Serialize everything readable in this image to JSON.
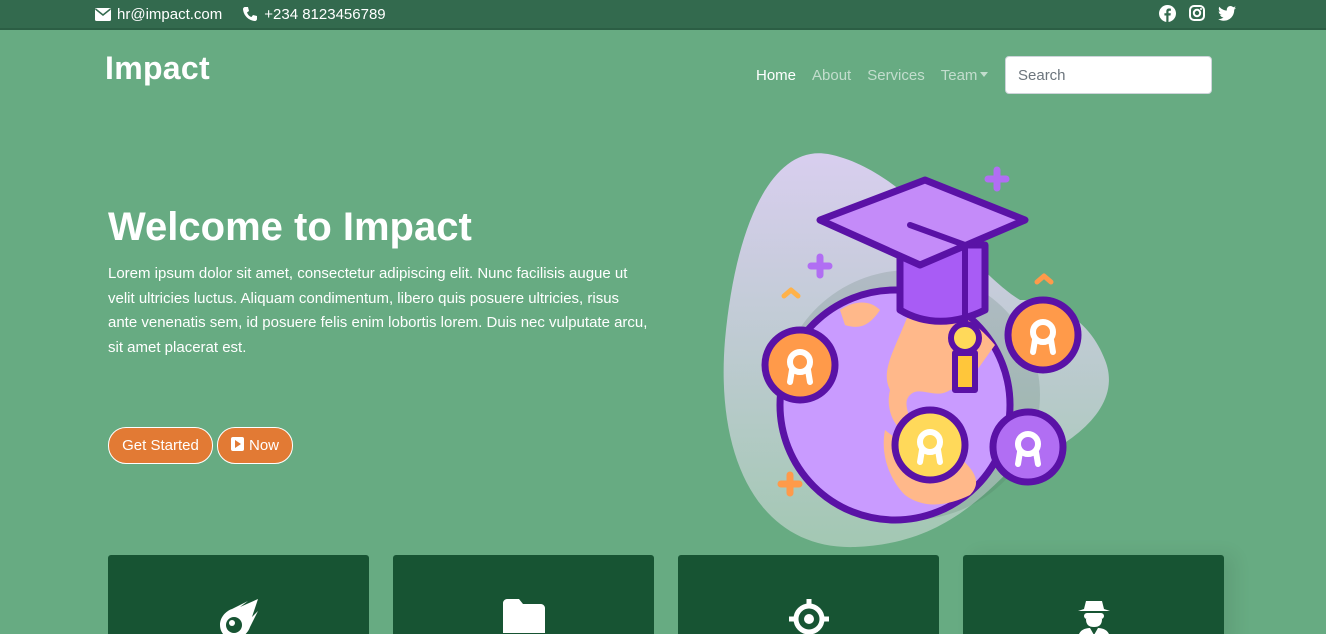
{
  "topbar": {
    "email": "hr@impact.com",
    "phone": "+234 8123456789",
    "social": [
      "facebook-icon",
      "instagram-icon",
      "twitter-icon"
    ]
  },
  "navbar": {
    "brand": "Impact",
    "links": [
      {
        "label": "Home",
        "active": true
      },
      {
        "label": "About"
      },
      {
        "label": "Services"
      },
      {
        "label": "Team"
      }
    ],
    "search_placeholder": "Search"
  },
  "hero": {
    "title": "Welcome to Impact",
    "text": "Lorem ipsum dolor sit amet, consectetur adipiscing elit. Nunc facilisis augue ut velit ultricies luctus. Aliquam condimentum, libero quis posuere ultricies, risus ante venenatis sem, id posuere felis enim lobortis lorem. Duis nec vulputate arcu, sit amet placerat est.",
    "primary_button": "Get Started",
    "secondary_button": "Now"
  },
  "cards": [
    {
      "icon": "meteor-icon"
    },
    {
      "icon": "folder-icon"
    },
    {
      "icon": "crosshairs-icon"
    },
    {
      "icon": "user-secret-icon"
    }
  ],
  "colors": {
    "page_bg": "#67ab82",
    "topbar_bg": "#336a4e",
    "card_bg": "#175433",
    "button_bg": "#e27a34"
  }
}
